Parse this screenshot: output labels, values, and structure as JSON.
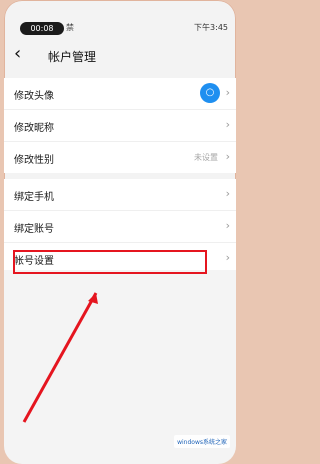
{
  "status": {
    "time": "00:08",
    "left_icon_text": "禁",
    "clock_text": "下午3:45"
  },
  "header": {
    "back_symbol": "‹",
    "title": "帐户管理"
  },
  "groups": [
    [
      {
        "label": "修改头像",
        "kind": "avatar"
      },
      {
        "label": "修改昵称"
      },
      {
        "label": "修改性别",
        "value": "未设置"
      }
    ],
    [
      {
        "label": "绑定手机"
      },
      {
        "label": "绑定账号"
      },
      {
        "label": "帐号设置"
      }
    ]
  ],
  "watermark": "windows系统之家",
  "colors": {
    "accent": "#1f8ff0",
    "highlight": "#e5151f"
  }
}
